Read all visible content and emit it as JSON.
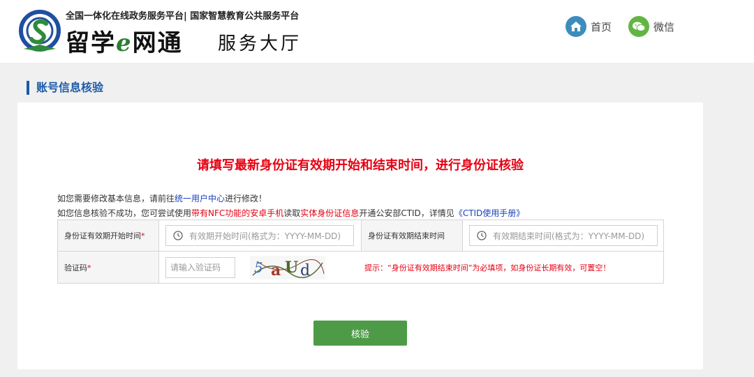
{
  "header": {
    "subtitle": "全国一体化在线政务服务平台| 国家智慧教育公共服务平台",
    "brand_pre": "留学",
    "brand_e": "e",
    "brand_post": "网通",
    "hall": "服务大厅",
    "nav": {
      "home": {
        "label": "首页",
        "icon": "home-icon"
      },
      "wechat": {
        "label": "微信",
        "icon": "wechat-icon"
      }
    }
  },
  "section": {
    "title": "账号信息核验"
  },
  "main": {
    "headline": "请填写最新身份证有效期开始和结束时间，进行身份证核验",
    "notice1": {
      "pre": "如您需要修改基本信息，请前往",
      "link": "统一用户中心",
      "post": "进行修改！"
    },
    "notice2": {
      "pre": "如您信息核验不成功，您可尝试使用",
      "red1": "带有NFC功能的安卓手机",
      "mid": "读取",
      "red2": "实体身份证信息",
      "mid2": "开通公安部CTID，详情见",
      "link": "《CTID使用手册》"
    },
    "form": {
      "start_label": "身份证有效期开始时间",
      "start_placeholder": "有效期开始时间(格式为：YYYY-MM-DD)",
      "end_label": "身份证有效期结束时间",
      "end_placeholder": "有效期结束时间(格式为：YYYY-MM-DD)",
      "captcha_label": "验证码",
      "required_mark": "*",
      "captcha_placeholder": "请输入验证码",
      "captcha_text": "5aUd",
      "tip": "提示：“身份证有效期结束时间”为必填项，如身份证长期有效，可置空！"
    },
    "submit_label": "核验"
  },
  "colors": {
    "accent_blue": "#1a5ba8",
    "alert_red": "#e60012",
    "button_green": "#4e9b47",
    "link_blue": "#1a3fbf"
  }
}
